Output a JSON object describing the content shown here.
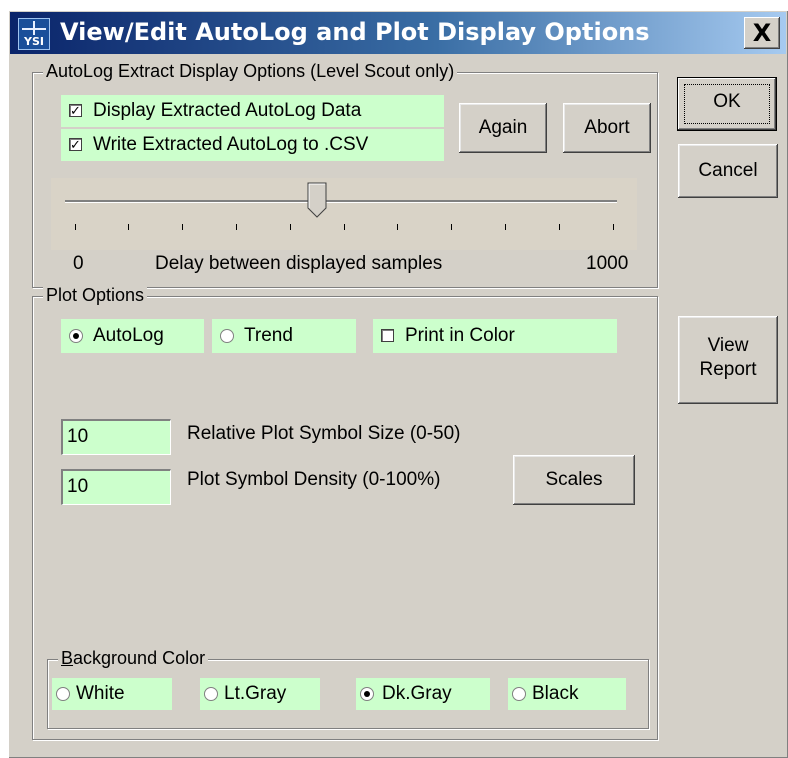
{
  "window": {
    "title": "View/Edit AutoLog and Plot Display Options",
    "logo_text": "YSI",
    "close_symbol": "X"
  },
  "extract_group": {
    "legend": "AutoLog Extract Display Options (Level Scout only)",
    "display_extracted": {
      "label": "Display Extracted AutoLog Data",
      "checked": true
    },
    "write_csv": {
      "label": "Write Extracted AutoLog to .CSV",
      "checked": true
    },
    "again_label": "Again",
    "abort_label": "Abort",
    "slider": {
      "min_label": "0",
      "max_label": "1000",
      "caption": "Delay between displayed samples",
      "value_fraction": 0.45
    }
  },
  "plot_group": {
    "legend": "Plot Options",
    "autolog_label": "AutoLog",
    "trend_label": "Trend",
    "print_color_label": "Print in Color",
    "plot_mode_selected": "AutoLog",
    "print_in_color": false,
    "symbol_size": {
      "value": "10",
      "label": "Relative Plot Symbol Size (0-50)"
    },
    "symbol_density": {
      "value": "10",
      "label": "Plot Symbol Density (0-100%)"
    },
    "scales_label": "Scales"
  },
  "background_group": {
    "legend_accel": "B",
    "legend_rest": "ackground Color",
    "options": [
      "White",
      "Lt.Gray",
      "Dk.Gray",
      "Black"
    ],
    "selected": "Dk.Gray"
  },
  "side_buttons": {
    "ok": "OK",
    "cancel": "Cancel",
    "view_line1": "View",
    "view_line2": "Report"
  },
  "colors": {
    "field_green": "#ccffcc",
    "dialog_gray": "#d4d0c8",
    "title_start": "#0a246a",
    "title_end": "#a6caf0"
  }
}
